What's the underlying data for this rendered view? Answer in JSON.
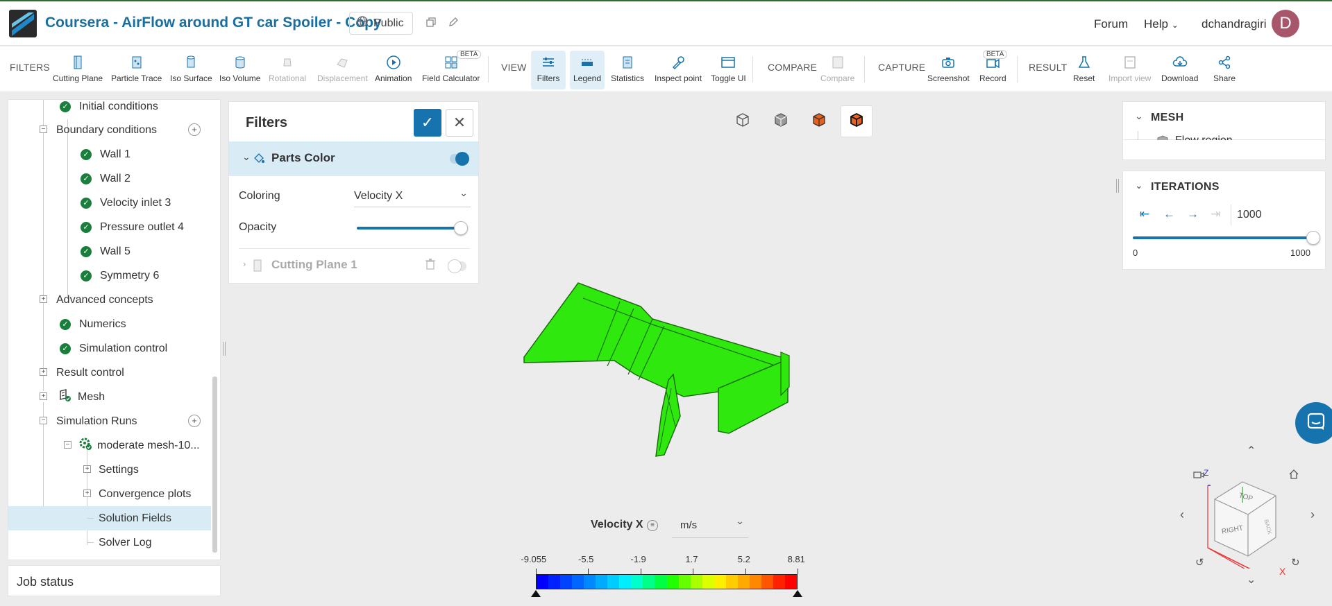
{
  "header": {
    "title": "Coursera - AirFlow around GT car Spoiler - Copy",
    "visibility": "Public",
    "forum": "Forum",
    "help": "Help",
    "username": "dchandragiri",
    "avatar_letter": "D"
  },
  "toolbar": {
    "sections": {
      "filters": "FILTERS",
      "view": "VIEW",
      "compare": "COMPARE",
      "capture": "CAPTURE",
      "result": "RESULT"
    },
    "filters": [
      {
        "label": "Cutting Plane",
        "icon": "cutting-plane-icon"
      },
      {
        "label": "Particle Trace",
        "icon": "particle-trace-icon"
      },
      {
        "label": "Iso Surface",
        "icon": "iso-surface-icon"
      },
      {
        "label": "Iso Volume",
        "icon": "iso-volume-icon"
      },
      {
        "label": "Rotational",
        "icon": "rotational-icon"
      },
      {
        "label": "Displacement",
        "icon": "displacement-icon"
      },
      {
        "label": "Animation",
        "icon": "animation-icon"
      },
      {
        "label": "Field Calculator",
        "icon": "field-calculator-icon",
        "badge": "BETA"
      }
    ],
    "view": [
      {
        "label": "Filters"
      },
      {
        "label": "Legend"
      },
      {
        "label": "Statistics"
      },
      {
        "label": "Inspect point"
      },
      {
        "label": "Toggle UI"
      }
    ],
    "compare": [
      {
        "label": "Compare"
      }
    ],
    "capture": [
      {
        "label": "Screenshot"
      },
      {
        "label": "Record",
        "badge": "BETA"
      }
    ],
    "result": [
      {
        "label": "Reset"
      },
      {
        "label": "Import view"
      },
      {
        "label": "Download"
      },
      {
        "label": "Share"
      }
    ]
  },
  "tree": {
    "items": [
      {
        "label": "Initial conditions"
      },
      {
        "label": "Boundary conditions"
      },
      {
        "label": "Wall 1"
      },
      {
        "label": "Wall 2"
      },
      {
        "label": "Velocity inlet 3"
      },
      {
        "label": "Pressure outlet 4"
      },
      {
        "label": "Wall 5"
      },
      {
        "label": "Symmetry 6"
      },
      {
        "label": "Advanced concepts"
      },
      {
        "label": "Numerics"
      },
      {
        "label": "Simulation control"
      },
      {
        "label": "Result control"
      },
      {
        "label": "Mesh"
      },
      {
        "label": "Simulation Runs"
      },
      {
        "label": "moderate mesh-10..."
      },
      {
        "label": "Settings"
      },
      {
        "label": "Convergence plots"
      },
      {
        "label": "Solution Fields"
      },
      {
        "label": "Solver Log"
      }
    ]
  },
  "job_status": "Job status",
  "filters_panel": {
    "title": "Filters",
    "parts_color": "Parts Color",
    "coloring_label": "Coloring",
    "coloring_value": "Velocity X",
    "opacity_label": "Opacity",
    "opacity_level": 1.0,
    "cutting_plane": "Cutting Plane 1"
  },
  "mesh_panel": {
    "title": "MESH",
    "item": "Flow region"
  },
  "iterations_panel": {
    "title": "ITERATIONS",
    "value": "1000",
    "min": "0",
    "max": "1000",
    "slider_level": 1.0
  },
  "legend": {
    "title": "Velocity X",
    "unit": "m/s",
    "ticks": [
      "-9.055",
      "-5.5",
      "-1.9",
      "1.7",
      "5.2",
      "8.81"
    ]
  },
  "viewcube": {
    "top": "TOP",
    "right": "RIGHT",
    "back": "BACK",
    "axis_x": "X",
    "axis_z": "Z"
  },
  "colors": {
    "accent": "#1673ad",
    "check_green": "#1a7f3c",
    "model_green": "#2ee80e",
    "selected_bg": "#d9ebf5"
  }
}
